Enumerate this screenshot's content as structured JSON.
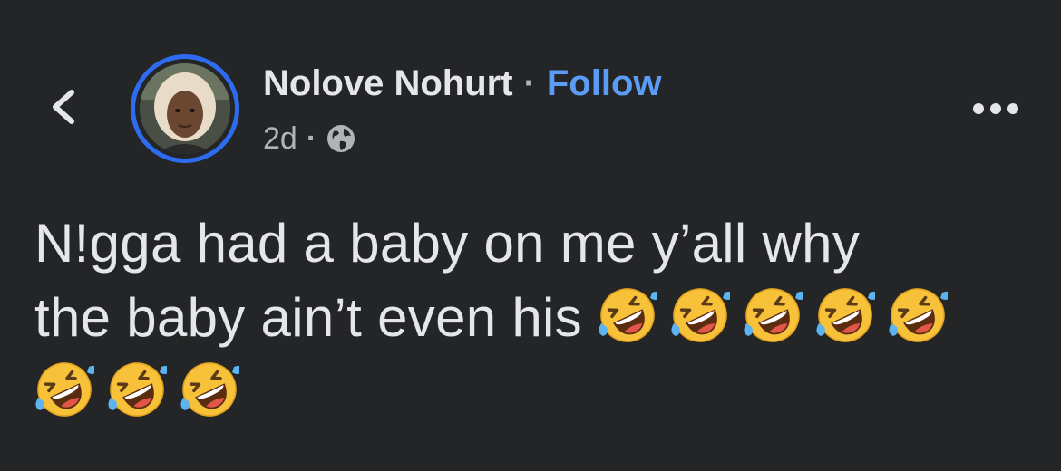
{
  "post": {
    "author": "Nolove Nohurt",
    "separator": "·",
    "follow_label": "Follow",
    "timestamp": "2d",
    "meta_separator": "·",
    "privacy_icon": "globe-icon",
    "text_line1": "N!gga had a baby on me y’all why",
    "text_line2": "the baby ain’t even his",
    "emoji_name": "rolling-on-the-floor-laughing",
    "emoji_count": 8
  },
  "icons": {
    "back": "chevron-left-icon",
    "more": "more-horizontal-icon"
  },
  "colors": {
    "background": "#242526",
    "text": "#e4e6eb",
    "secondary_text": "#b0b3b8",
    "follow_link": "#5b9cf6",
    "avatar_ring": "#2d6cf0"
  }
}
